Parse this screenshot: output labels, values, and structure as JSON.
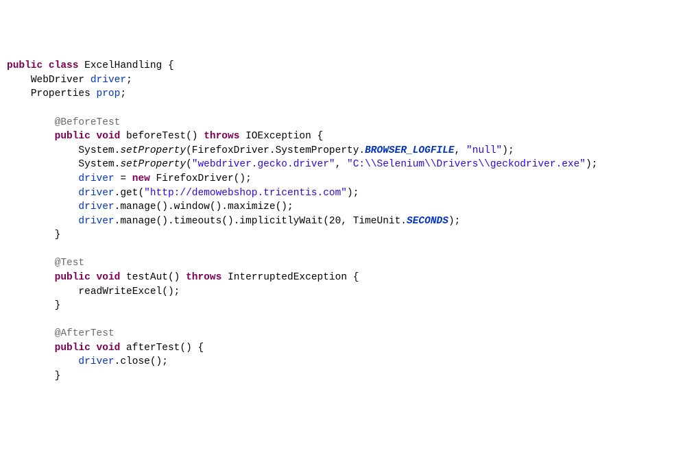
{
  "t": {
    "l1_public": "public",
    "l1_class": "class",
    "l1_name": "ExcelHandling",
    "l1_brace": " {",
    "l2_type": "WebDriver",
    "l2_field": "driver",
    "l2_semi": ";",
    "l3_type": "Properties",
    "l3_field": "prop",
    "l3_semi": ";",
    "l4_anno": "@BeforeTest",
    "l5_public": "public",
    "l5_void": "void",
    "l5_name": " beforeTest() ",
    "l5_throws": "throws",
    "l5_ex": " IOException {",
    "l6_a": "System.",
    "l6_set": "setProperty",
    "l6_b": "(FirefoxDriver.SystemProperty.",
    "l6_sf": "BROWSER_LOGFILE",
    "l6_c": ", ",
    "l6_str": "\"null\"",
    "l6_d": ");",
    "l7_a": "System.",
    "l7_set": "setProperty",
    "l7_b": "(",
    "l7_s1": "\"webdriver.gecko.driver\"",
    "l7_c": ", ",
    "l7_s2": "\"C:\\\\Selenium\\\\Drivers\\\\geckodriver.exe\"",
    "l7_d": ");",
    "l8_drv": "driver",
    "l8_eq": " = ",
    "l8_new": "new",
    "l8_rest": " FirefoxDriver();",
    "l9_drv": "driver",
    "l9_a": ".get(",
    "l9_s": "\"http://demowebshop.tricentis.com\"",
    "l9_b": ");",
    "l10_drv": "driver",
    "l10_rest": ".manage().window().maximize();",
    "l11_drv": "driver",
    "l11_a": ".manage().timeouts().implicitlyWait(20, TimeUnit.",
    "l11_sf": "SECONDS",
    "l11_b": ");",
    "l12_brace": "}",
    "l13_anno": "@Test",
    "l14_public": "public",
    "l14_void": "void",
    "l14_name": " testAut() ",
    "l14_throws": "throws",
    "l14_ex": " InterruptedException {",
    "l15_call": "readWriteExcel();",
    "l16_brace": "}",
    "l17_anno": "@AfterTest",
    "l18_public": "public",
    "l18_void": "void",
    "l18_name": " afterTest() {",
    "l19_drv": "driver",
    "l19_rest": ".close();",
    "l20_brace": "}"
  }
}
